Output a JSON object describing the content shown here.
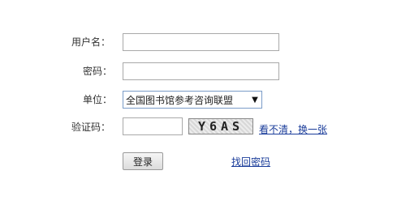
{
  "form": {
    "username": {
      "label": "用户名：",
      "value": "",
      "placeholder": ""
    },
    "password": {
      "label": "密码：",
      "value": "",
      "placeholder": ""
    },
    "unit": {
      "label": "单位：",
      "selected": "全国图书馆参考咨询联盟",
      "arrow": "▼"
    },
    "captcha": {
      "label": "验证码：",
      "value": "",
      "placeholder": "",
      "image_text": "Y6AS",
      "refresh_link": "看不清，换一张"
    },
    "login_button": "登录",
    "forgot_password_link": "找回密码"
  }
}
